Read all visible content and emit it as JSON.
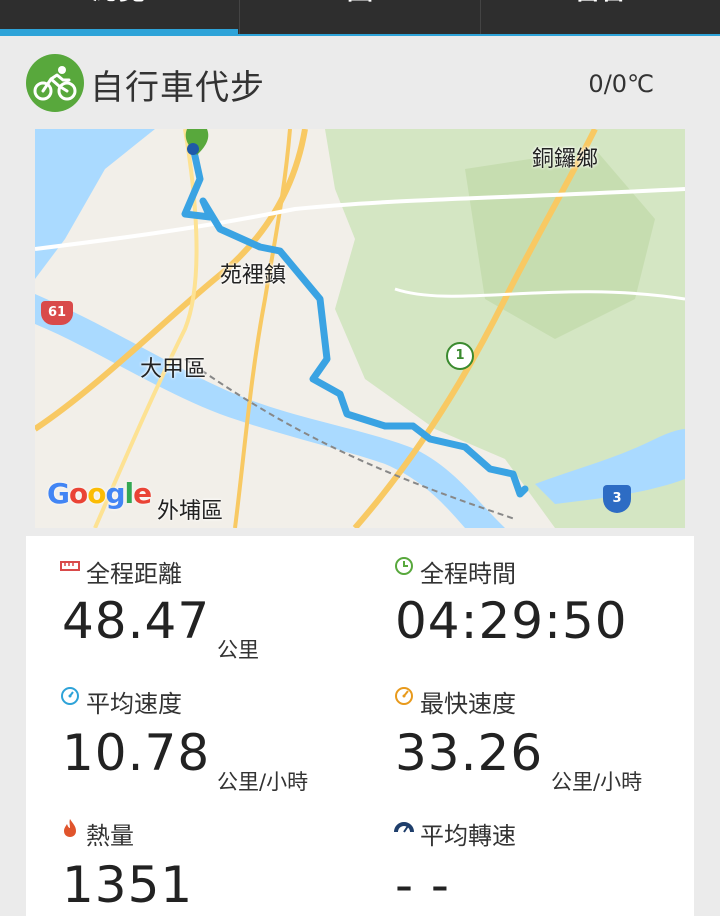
{
  "tabs": [
    {
      "label": "總覽"
    },
    {
      "label": "圖"
    },
    {
      "label": "留言"
    }
  ],
  "activity": {
    "title": "自行車代步",
    "weather": "0/0℃",
    "icon": "bicycle-icon",
    "icon_color": "#58a83c"
  },
  "map": {
    "labels": {
      "tongluo": "銅鑼鄉",
      "yuanli": "苑裡鎮",
      "dajia": "大甲區",
      "waipu": "外埔區"
    },
    "road_shields": {
      "r61": "61",
      "r1": "1",
      "r3": "3"
    },
    "attribution": "Google",
    "route_color": "#3aa3e3"
  },
  "stats": {
    "distance": {
      "label": "全程距離",
      "value": "48.47",
      "unit": "公里",
      "icon": "ruler-icon"
    },
    "duration": {
      "label": "全程時間",
      "value": "04:29:50",
      "icon": "clock-icon"
    },
    "avg_speed": {
      "label": "平均速度",
      "value": "10.78",
      "unit": "公里/小時",
      "icon": "speedometer-icon"
    },
    "max_speed": {
      "label": "最快速度",
      "value": "33.26",
      "unit": "公里/小時",
      "icon": "max-speed-icon"
    },
    "calories": {
      "label": "熱量",
      "value": "1351",
      "icon": "flame-icon"
    },
    "cadence": {
      "label": "平均轉速",
      "value": "- -",
      "icon": "cadence-gauge-icon"
    }
  },
  "colors": {
    "tab_bar": "#2e2e2e",
    "tab_accent": "#2ea3d8",
    "background": "#ebebeb"
  }
}
